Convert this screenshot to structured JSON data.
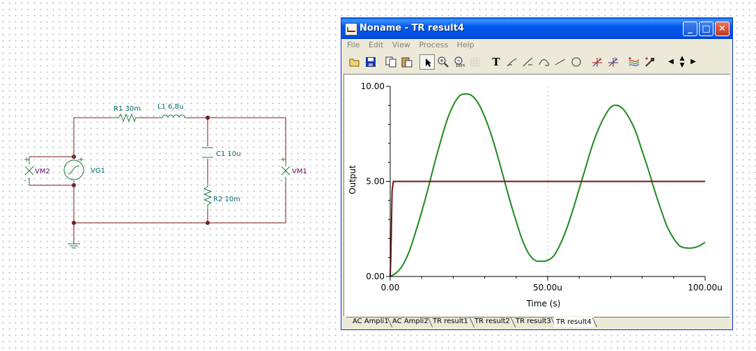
{
  "schematic": {
    "components": {
      "r1": "R1 30m",
      "l1": "L1 6,8u",
      "c1": "C1 10u",
      "r2": "R2 10m",
      "vg1": "VG1",
      "vm1": "VM1",
      "vm2": "VM2"
    },
    "colors": {
      "wire": "#7a1a1a",
      "component": "#1a7a3a",
      "label": "#006a6a",
      "meter": "#6a0a6a"
    }
  },
  "window": {
    "title": "Noname - TR result4",
    "buttons": {
      "minimize": "_",
      "maximize": "□",
      "close": "✕"
    },
    "menu": [
      "File",
      "Edit",
      "View",
      "Process",
      "Help"
    ],
    "toolbar_icons": [
      "open-icon",
      "save-icon",
      "copy-icon",
      "paste-icon",
      "pointer-icon",
      "zoom-in-icon",
      "zoom-full-icon",
      "grid-icon",
      "text-icon",
      "cursor-a-icon",
      "cursor-b-icon",
      "curve-icon",
      "line-icon",
      "circle-icon",
      "marker-a-icon",
      "marker-b-icon",
      "waves-icon",
      "probe-icon",
      "scroll-left-icon",
      "scroll-updown-icon",
      "scroll-right-icon"
    ],
    "tabs": [
      "AC Ampli1",
      "AC Ampli2",
      "TR result1",
      "TR result2",
      "TR result3",
      "TR result4"
    ],
    "active_tab": "TR result4"
  },
  "chart_data": {
    "type": "line",
    "title": "",
    "xlabel": "Time (s)",
    "ylabel": "Output",
    "xlim": [
      0,
      100
    ],
    "ylim": [
      0,
      10
    ],
    "xticks": [
      "0.00",
      "50.00u",
      "100.00u"
    ],
    "yticks": [
      "0.00",
      "5.00",
      "10.00"
    ],
    "grid": "vertical at x=50",
    "series": [
      {
        "color": "#1e8a1e",
        "x": [
          0,
          2,
          4,
          6,
          8,
          10,
          12,
          14,
          16,
          18,
          20,
          22,
          24,
          26,
          28,
          30,
          32,
          34,
          36,
          38,
          40,
          42,
          44,
          46,
          48,
          50,
          52,
          54,
          56,
          58,
          60,
          62,
          64,
          66,
          68,
          70,
          72,
          74,
          76,
          78,
          80,
          82,
          84,
          86,
          88,
          90,
          92,
          94,
          96,
          98,
          100
        ],
        "y": [
          0.0,
          0.2,
          0.6,
          1.3,
          2.3,
          3.4,
          4.6,
          5.9,
          7.1,
          8.2,
          9.0,
          9.5,
          9.6,
          9.5,
          9.1,
          8.4,
          7.5,
          6.4,
          5.2,
          4.0,
          2.9,
          1.9,
          1.2,
          0.85,
          0.8,
          0.85,
          1.1,
          1.7,
          2.5,
          3.5,
          4.6,
          5.7,
          6.8,
          7.7,
          8.4,
          8.9,
          9.0,
          8.8,
          8.3,
          7.6,
          6.6,
          5.6,
          4.5,
          3.5,
          2.6,
          2.0,
          1.6,
          1.5,
          1.5,
          1.6,
          1.8
        ]
      },
      {
        "color": "#7a1010",
        "x": [
          0,
          0.2,
          0.6,
          1.0,
          100
        ],
        "y": [
          0,
          1.0,
          4.5,
          5.0,
          5.0
        ]
      }
    ]
  }
}
